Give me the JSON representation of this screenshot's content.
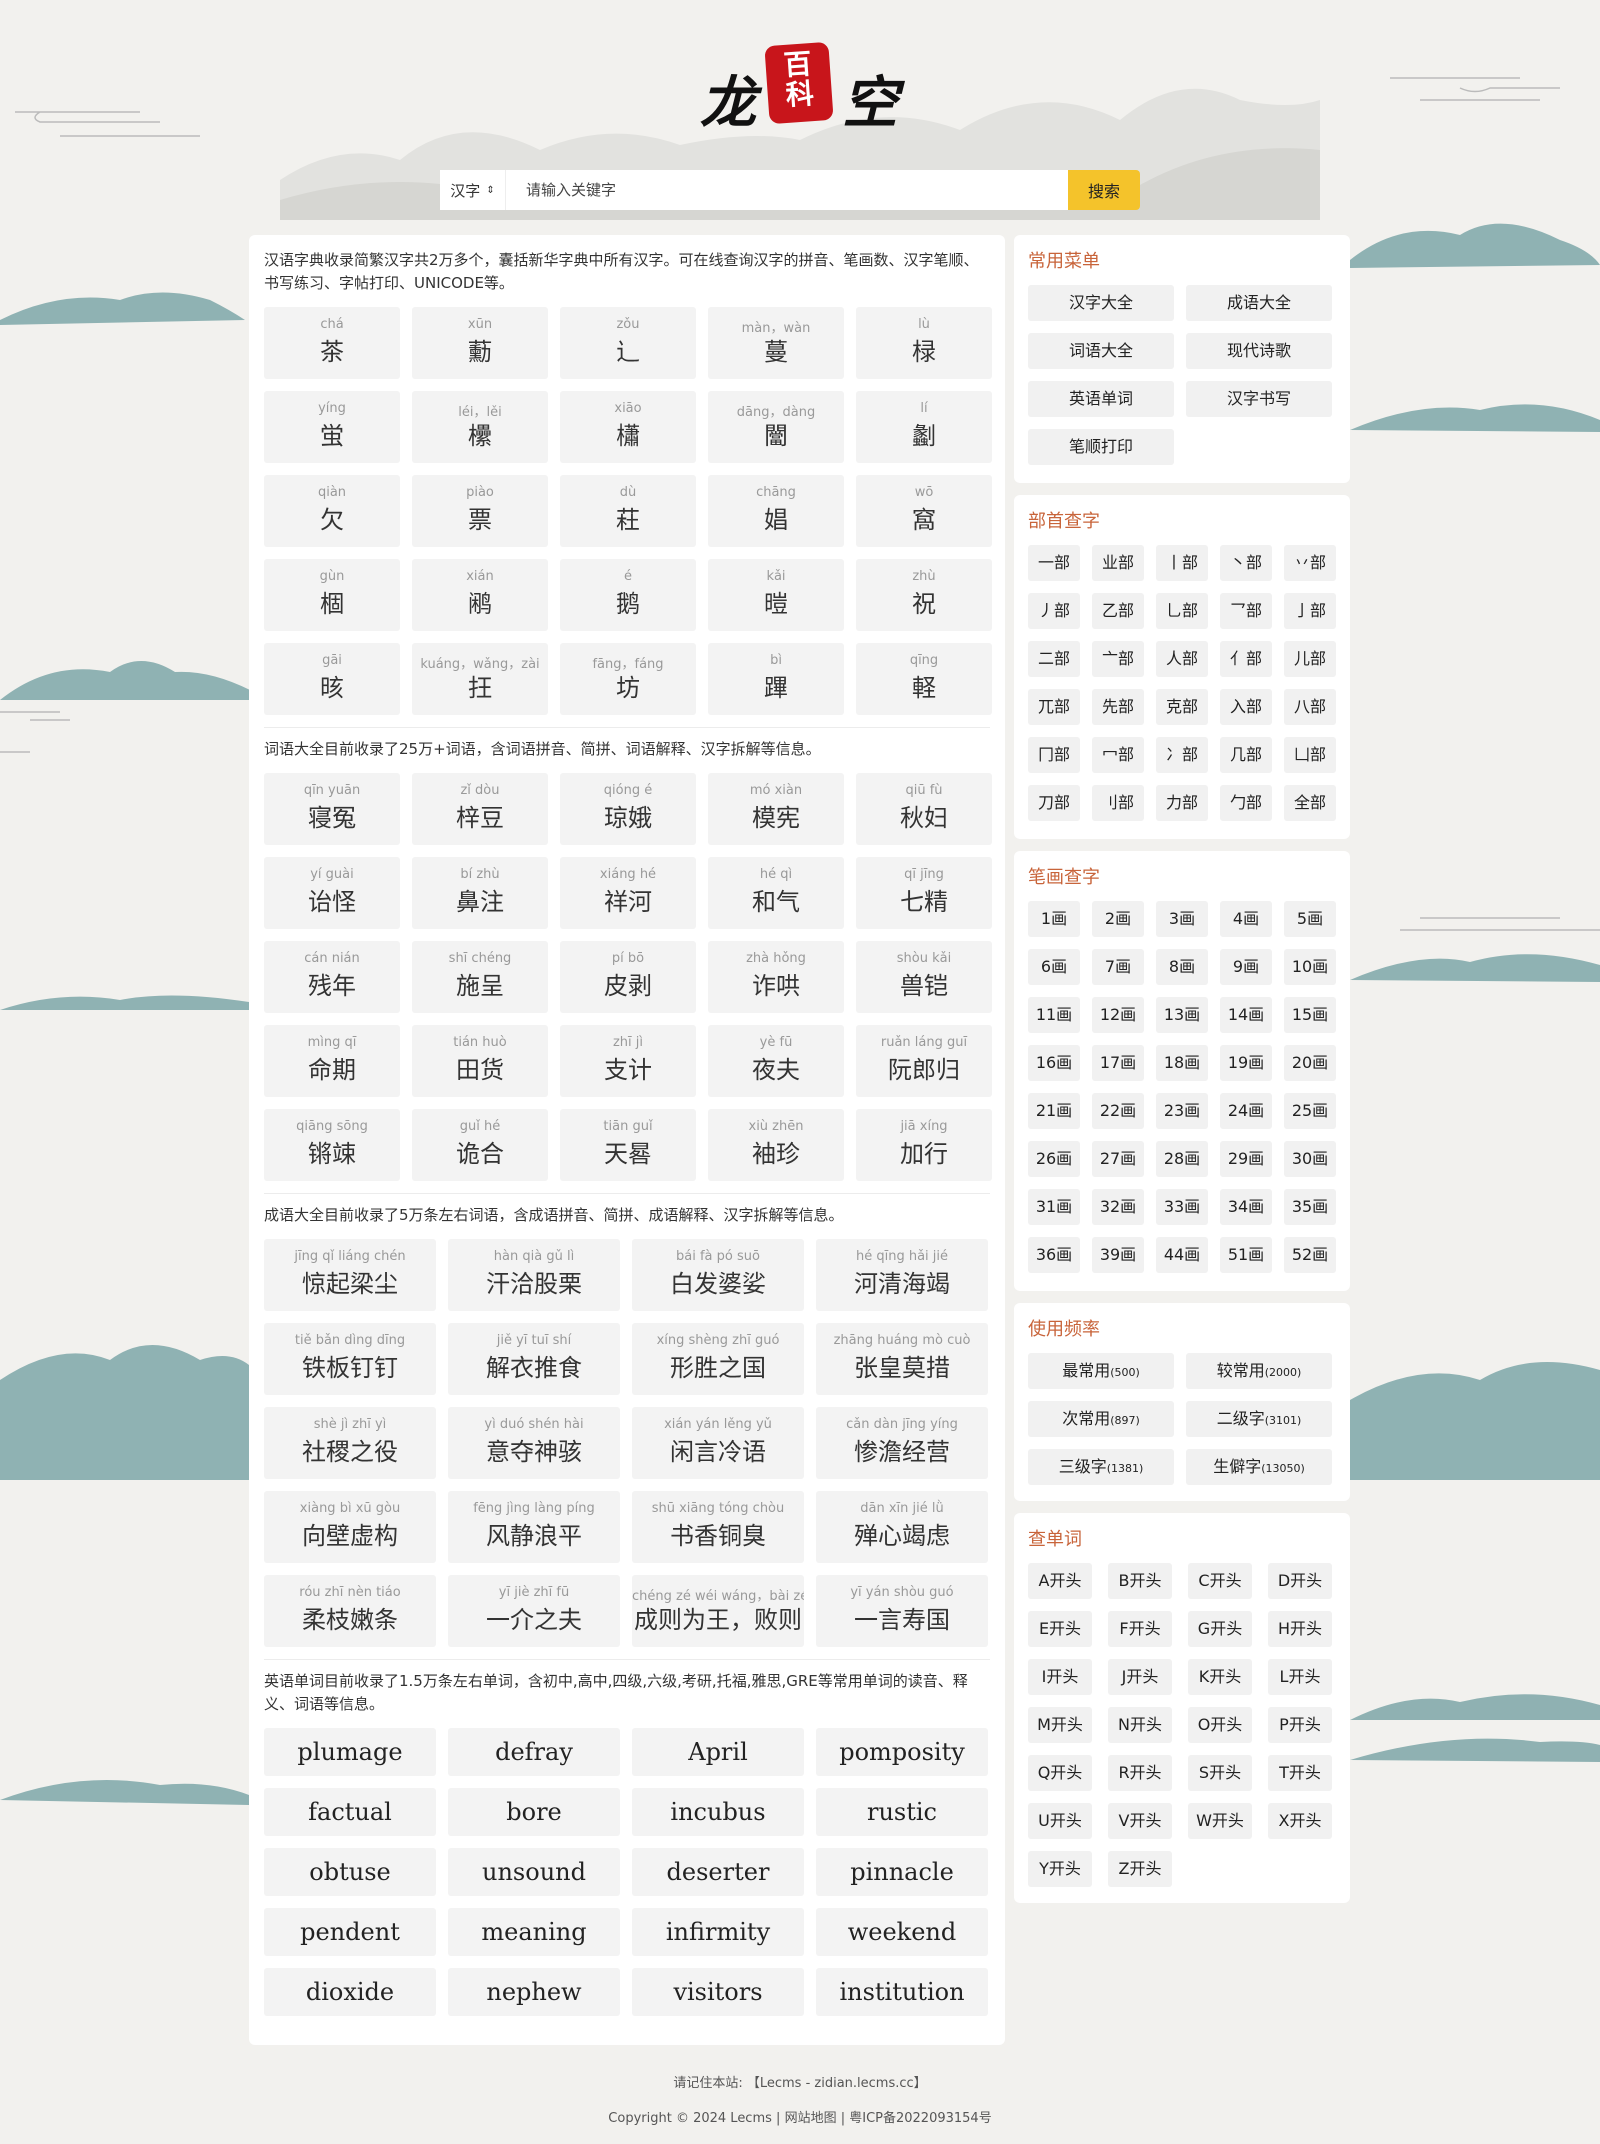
{
  "brand": {
    "char1": "龙",
    "seal1": "百",
    "seal2": "科",
    "char2": "空"
  },
  "search": {
    "type": "汉字",
    "placeholder": "请输入关键字",
    "button": "搜索"
  },
  "chars": {
    "intro": "汉语字典收录简繁汉字共2万多个，囊括新华字典中所有汉字。可在线查询汉字的拼音、笔画数、汉字笔顺、书写练习、字帖打印、UNICODE等。",
    "items": [
      {
        "py": "chá",
        "hz": "茶"
      },
      {
        "py": "xūn",
        "hz": "蘍"
      },
      {
        "py": "zǒu",
        "hz": "辶"
      },
      {
        "py": "màn，wàn",
        "hz": "蔓"
      },
      {
        "py": "lù",
        "hz": "椂"
      },
      {
        "py": "yíng",
        "hz": "蛍"
      },
      {
        "py": "léi，lěi",
        "hz": "欙"
      },
      {
        "py": "xiāo",
        "hz": "櫹"
      },
      {
        "py": "dāng，dàng",
        "hz": "闣"
      },
      {
        "py": "lí",
        "hz": "劙"
      },
      {
        "py": "qiàn",
        "hz": "欠"
      },
      {
        "py": "piào",
        "hz": "票"
      },
      {
        "py": "dù",
        "hz": "荰"
      },
      {
        "py": "chāng",
        "hz": "娼"
      },
      {
        "py": "wō",
        "hz": "窩"
      },
      {
        "py": "gùn",
        "hz": "棝"
      },
      {
        "py": "xián",
        "hz": "鹇"
      },
      {
        "py": "é",
        "hz": "鹅"
      },
      {
        "py": "kǎi",
        "hz": "暟"
      },
      {
        "py": "zhù",
        "hz": "祝"
      },
      {
        "py": "gāi",
        "hz": "晐"
      },
      {
        "py": "kuáng，wǎng，zài",
        "hz": "抂"
      },
      {
        "py": "fāng，fáng",
        "hz": "坊"
      },
      {
        "py": "bì",
        "hz": "蹕"
      },
      {
        "py": "qīng",
        "hz": "軽"
      }
    ]
  },
  "words": {
    "intro": "词语大全目前收录了25万+词语，含词语拼音、简拼、词语解释、汉字拆解等信息。",
    "items": [
      {
        "py": "qīn yuān",
        "hz": "寝冤"
      },
      {
        "py": "zǐ dòu",
        "hz": "梓豆"
      },
      {
        "py": "qióng é",
        "hz": "琼娥"
      },
      {
        "py": "mó xiàn",
        "hz": "模宪"
      },
      {
        "py": "qiū fù",
        "hz": "秋妇"
      },
      {
        "py": "yí guài",
        "hz": "诒怪"
      },
      {
        "py": "bí zhù",
        "hz": "鼻注"
      },
      {
        "py": "xiáng hé",
        "hz": "祥河"
      },
      {
        "py": "hé qì",
        "hz": "和气"
      },
      {
        "py": "qī jīng",
        "hz": "七精"
      },
      {
        "py": "cán nián",
        "hz": "残年"
      },
      {
        "py": "shī chéng",
        "hz": "施呈"
      },
      {
        "py": "pí bō",
        "hz": "皮剥"
      },
      {
        "py": "zhà hǒng",
        "hz": "诈哄"
      },
      {
        "py": "shòu kǎi",
        "hz": "兽铠"
      },
      {
        "py": "mìng qī",
        "hz": "命期"
      },
      {
        "py": "tián huò",
        "hz": "田货"
      },
      {
        "py": "zhī jì",
        "hz": "支计"
      },
      {
        "py": "yè fū",
        "hz": "夜夫"
      },
      {
        "py": "ruǎn láng guī",
        "hz": "阮郎归"
      },
      {
        "py": "qiāng sōng",
        "hz": "锵竦"
      },
      {
        "py": "guǐ hé",
        "hz": "诡合"
      },
      {
        "py": "tiān guǐ",
        "hz": "天晷"
      },
      {
        "py": "xiù zhēn",
        "hz": "袖珍"
      },
      {
        "py": "jiā xíng",
        "hz": "加行"
      }
    ]
  },
  "idioms": {
    "intro": "成语大全目前收录了5万条左右词语，含成语拼音、简拼、成语解释、汉字拆解等信息。",
    "items": [
      {
        "py": "jīng qǐ liáng chén",
        "hz": "惊起梁尘"
      },
      {
        "py": "hàn qià gǔ lì",
        "hz": "汗洽股栗"
      },
      {
        "py": "bái fà pó suō",
        "hz": "白发婆娑"
      },
      {
        "py": "hé qīng hǎi jié",
        "hz": "河清海竭"
      },
      {
        "py": "tiě bǎn dìng dīng",
        "hz": "铁板钉钉"
      },
      {
        "py": "jiě yī tuī shí",
        "hz": "解衣推食"
      },
      {
        "py": "xíng shèng zhī guó",
        "hz": "形胜之国"
      },
      {
        "py": "zhāng huáng mò cuò",
        "hz": "张皇莫措"
      },
      {
        "py": "shè jì zhī yì",
        "hz": "社稷之役"
      },
      {
        "py": "yì duó shén hài",
        "hz": "意夺神骇"
      },
      {
        "py": "xián yán lěng yǔ",
        "hz": "闲言冷语"
      },
      {
        "py": "cǎn dàn jīng yíng",
        "hz": "惨澹经营"
      },
      {
        "py": "xiàng bì xū gòu",
        "hz": "向壁虚构"
      },
      {
        "py": "fēng jìng làng píng",
        "hz": "风静浪平"
      },
      {
        "py": "shū xiāng tóng chòu",
        "hz": "书香铜臭"
      },
      {
        "py": "dān xīn jié lǜ",
        "hz": "殚心竭虑"
      },
      {
        "py": "róu zhī nèn tiáo",
        "hz": "柔枝嫩条"
      },
      {
        "py": "yī jiè zhī fū",
        "hz": "一介之夫"
      },
      {
        "py": "chéng zé wéi wáng，bài zé",
        "hz": "成则为王，败则"
      },
      {
        "py": "yī yán shòu guó",
        "hz": "一言寿国"
      }
    ]
  },
  "english": {
    "intro": "英语单词目前收录了1.5万条左右单词，含初中,高中,四级,六级,考研,托福,雅思,GRE等常用单词的读音、释义、词语等信息。",
    "items": [
      "plumage",
      "defray",
      "April",
      "pomposity",
      "factual",
      "bore",
      "incubus",
      "rustic",
      "obtuse",
      "unsound",
      "deserter",
      "pinnacle",
      "pendent",
      "meaning",
      "infirmity",
      "weekend",
      "dioxide",
      "nephew",
      "visitors",
      "institution"
    ]
  },
  "menu": {
    "title": "常用菜单",
    "items": [
      "汉字大全",
      "成语大全",
      "词语大全",
      "现代诗歌",
      "英语单词",
      "汉字书写",
      "笔顺打印"
    ]
  },
  "radicals": {
    "title": "部首查字",
    "items": [
      "一部",
      "业部",
      "丨部",
      "丶部",
      "丷部",
      "丿部",
      "乙部",
      "乚部",
      "乛部",
      "亅部",
      "二部",
      "亠部",
      "人部",
      "亻部",
      "儿部",
      "兀部",
      "先部",
      "克部",
      "入部",
      "八部",
      "冂部",
      "冖部",
      "冫部",
      "几部",
      "凵部",
      "刀部",
      "刂部",
      "力部",
      "勹部",
      "全部"
    ]
  },
  "strokes": {
    "title": "笔画查字",
    "items": [
      "1画",
      "2画",
      "3画",
      "4画",
      "5画",
      "6画",
      "7画",
      "8画",
      "9画",
      "10画",
      "11画",
      "12画",
      "13画",
      "14画",
      "15画",
      "16画",
      "17画",
      "18画",
      "19画",
      "20画",
      "21画",
      "22画",
      "23画",
      "24画",
      "25画",
      "26画",
      "27画",
      "28画",
      "29画",
      "30画",
      "31画",
      "32画",
      "33画",
      "34画",
      "35画",
      "36画",
      "39画",
      "44画",
      "51画",
      "52画"
    ]
  },
  "frequency": {
    "title": "使用频率",
    "items": [
      {
        "label": "最常用",
        "count": "(500)"
      },
      {
        "label": "较常用",
        "count": "(2000)"
      },
      {
        "label": "次常用",
        "count": "(897)"
      },
      {
        "label": "二级字",
        "count": "(3101)"
      },
      {
        "label": "三级字",
        "count": "(1381)"
      },
      {
        "label": "生僻字",
        "count": "(13050)"
      }
    ]
  },
  "letters": {
    "title": "查单词",
    "items": [
      "A开头",
      "B开头",
      "C开头",
      "D开头",
      "E开头",
      "F开头",
      "G开头",
      "H开头",
      "I开头",
      "J开头",
      "K开头",
      "L开头",
      "M开头",
      "N开头",
      "O开头",
      "P开头",
      "Q开头",
      "R开头",
      "S开头",
      "T开头",
      "U开头",
      "V开头",
      "W开头",
      "X开头",
      "Y开头",
      "Z开头"
    ]
  },
  "footer": {
    "line1": "请记住本站: 【Lecms - zidian.lecms.cc】",
    "copyright": "Copyright © 2024 Lecms",
    "sitemap": "网站地图",
    "icp": "粤ICP备2022093154号"
  },
  "colors": {
    "accent": "#c8643a",
    "button": "#f4c32b",
    "wave": "#6a9ea1"
  }
}
